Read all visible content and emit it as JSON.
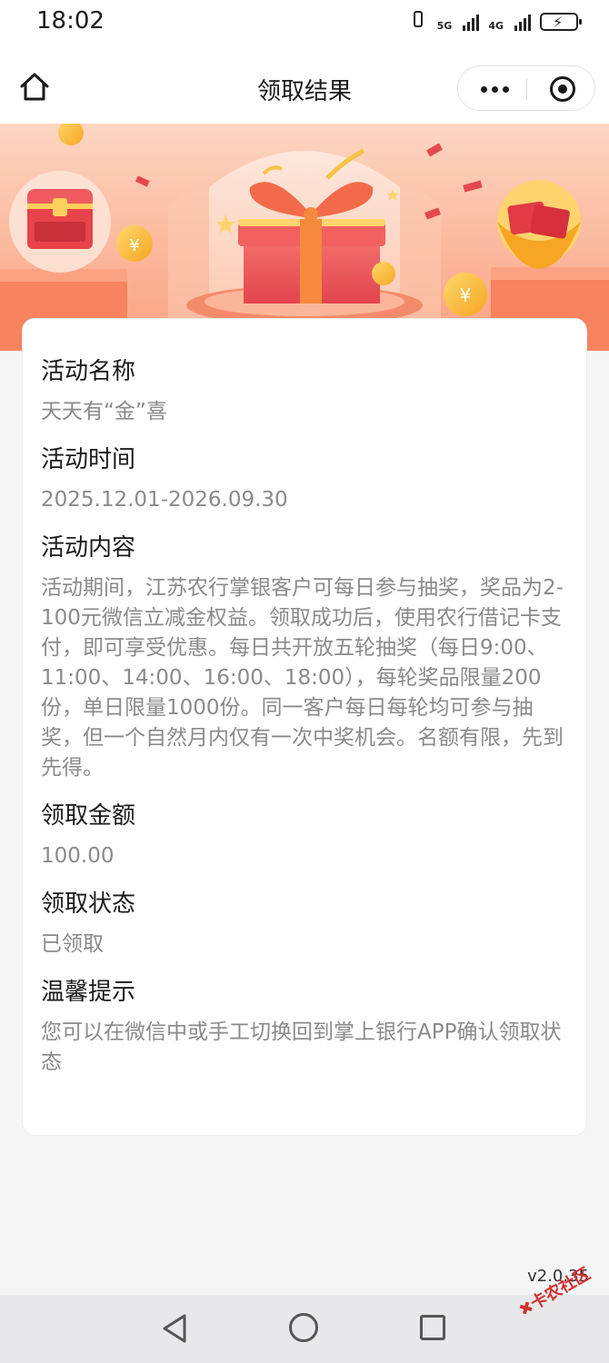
{
  "status_bar": {
    "time": "18:02",
    "network1": "5G",
    "network2": "4G"
  },
  "nav": {
    "title": "领取结果"
  },
  "sections": [
    {
      "title": "活动名称",
      "value": "天天有“金”喜"
    },
    {
      "title": "活动时间",
      "value": "2025.12.01-2026.09.30"
    },
    {
      "title": "活动内容",
      "value": "活动期间，江苏农行掌银客户可每日参与抽奖，奖品为2-100元微信立减金权益。领取成功后，使用农行借记卡支付，即可享受优惠。每日共开放五轮抽奖（每日9:00、11:00、14:00、16:00、18:00），每轮奖品限量200份，单日限量1000份。同一客户每日每轮均可参与抽奖，但一个自然月内仅有一次中奖机会。名额有限，先到先得。"
    },
    {
      "title": "领取金额",
      "value": "100.00"
    },
    {
      "title": "领取状态",
      "value": "已领取"
    },
    {
      "title": "温馨提示",
      "value": "您可以在微信中或手工切换回到掌上银行APP确认领取状态"
    }
  ],
  "version": "v2.0.35",
  "watermark": "卡农社区",
  "colors": {
    "banner_bg": "#fbb89b",
    "gift_box": "#e8505a",
    "gift_ribbon": "#f58a3c",
    "text_primary": "#1a1a1a",
    "text_secondary": "#8a8a8a"
  }
}
